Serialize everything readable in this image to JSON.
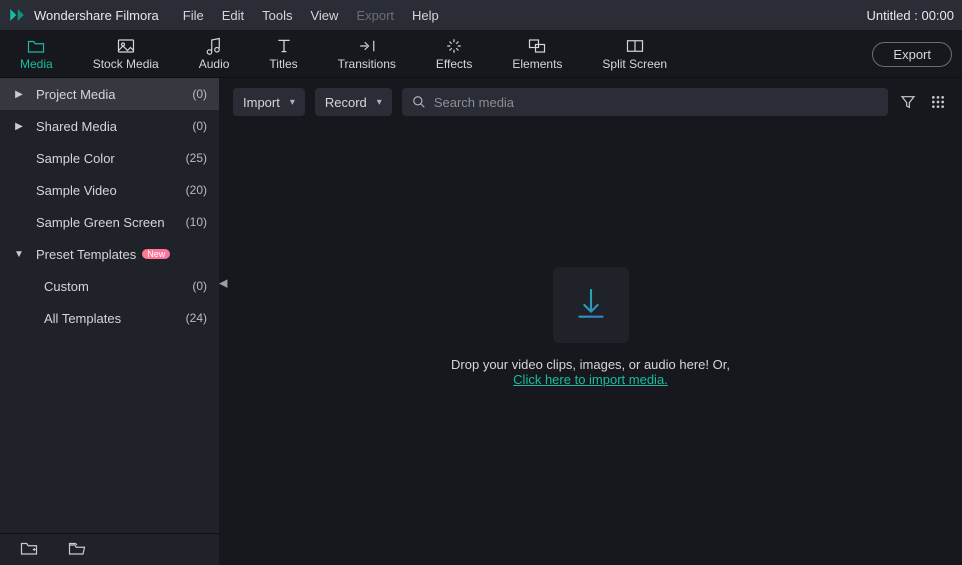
{
  "app_name": "Wondershare Filmora",
  "project_title": "Untitled : 00:00",
  "menu": {
    "file": "File",
    "edit": "Edit",
    "tools": "Tools",
    "view": "View",
    "export": "Export",
    "help": "Help"
  },
  "export_btn": "Export",
  "tabs": {
    "media": "Media",
    "stock": "Stock Media",
    "audio": "Audio",
    "titles": "Titles",
    "transitions": "Transitions",
    "effects": "Effects",
    "elements": "Elements",
    "split": "Split Screen"
  },
  "sidebar": {
    "items": [
      {
        "label": "Project Media",
        "count": "(0)",
        "arrow": "right",
        "active": true
      },
      {
        "label": "Shared Media",
        "count": "(0)",
        "arrow": "right"
      },
      {
        "label": "Sample Color",
        "count": "(25)"
      },
      {
        "label": "Sample Video",
        "count": "(20)"
      },
      {
        "label": "Sample Green Screen",
        "count": "(10)"
      },
      {
        "label": "Preset Templates",
        "arrow": "down",
        "badge": "New"
      },
      {
        "label": "Custom",
        "count": "(0)",
        "indent": true
      },
      {
        "label": "All Templates",
        "count": "(24)",
        "indent": true
      }
    ]
  },
  "content": {
    "import_label": "Import",
    "record_label": "Record",
    "search_placeholder": "Search media",
    "drop_text": "Drop your video clips, images, or audio here! Or,",
    "import_link": "Click here to import media."
  }
}
